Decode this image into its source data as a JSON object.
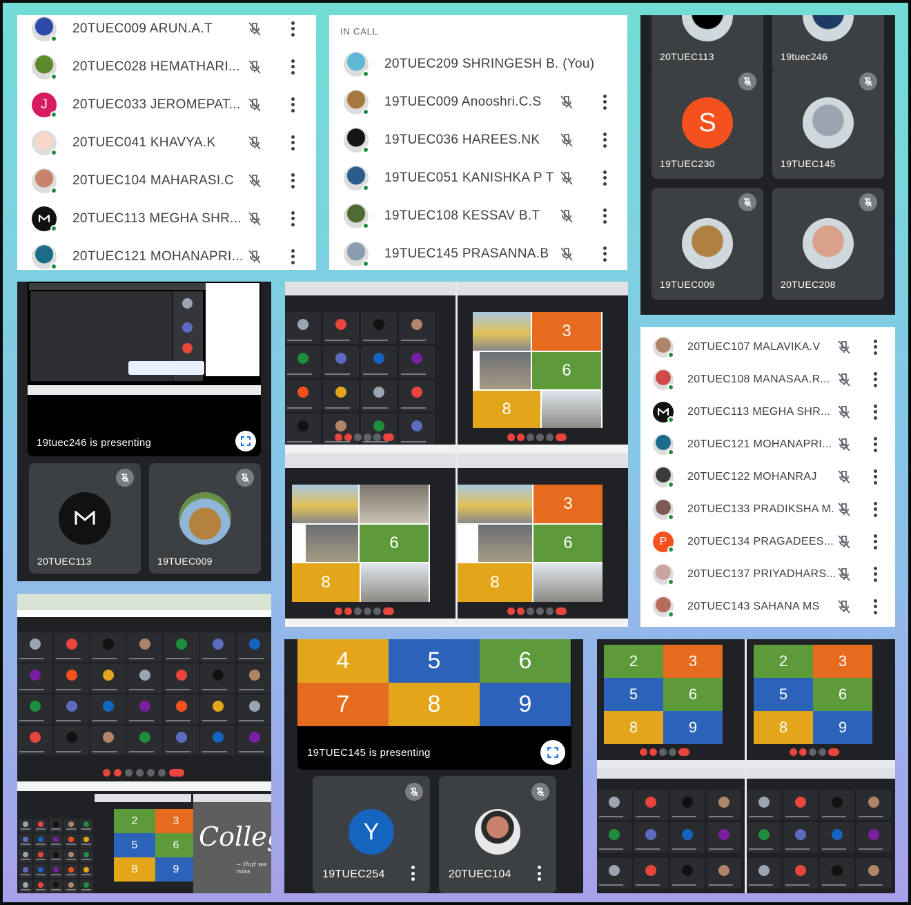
{
  "colors": {
    "green_online": "#1e8e3e",
    "orange": "#f2591b",
    "red": "#e8453c",
    "blue_y": "#1565c0",
    "grid_green": "#5d9a3a",
    "grid_orange": "#e66b1f",
    "grid_blue": "#2c63b8",
    "grid_yellow": "#e3a51a"
  },
  "panel1": {
    "participants": [
      {
        "name": "20TUEC009 ARUN.A.T",
        "avatar": "photo-globe",
        "color": "#2e4aa8"
      },
      {
        "name": "20TUEC028 HEMATHARI...",
        "avatar": "photo-fruit",
        "color": "#5a8a2a"
      },
      {
        "name": "20TUEC033 JEROMEPAT...",
        "avatar": "J",
        "color": "#d81b60"
      },
      {
        "name": "20TUEC041 KHAVYA.K",
        "avatar": "photo-signature",
        "color": "#f6d7c9"
      },
      {
        "name": "20TUEC104 MAHARASI.C",
        "avatar": "photo-person",
        "color": "#c9826b"
      },
      {
        "name": "20TUEC113 MEGHA SHR...",
        "avatar": "M-logo",
        "color": "#111111"
      },
      {
        "name": "20TUEC121 MOHANAPRI...",
        "avatar": "photo-person",
        "color": "#1b6b8a"
      }
    ]
  },
  "panel2": {
    "section_label": "IN CALL",
    "participants": [
      {
        "name": "20TUEC209 SHRINGESH B. (You)",
        "avatar": "photo-beach",
        "color": "#5fb7d4",
        "self": true
      },
      {
        "name": "19TUEC009 Anooshri.C.S",
        "avatar": "photo-dog",
        "color": "#a7783c"
      },
      {
        "name": "19TUEC036 HAREES.NK",
        "avatar": "photo-dark",
        "color": "#151515"
      },
      {
        "name": "19TUEC051 KANISHKA P T",
        "avatar": "photo-nature",
        "color": "#2a5d8a"
      },
      {
        "name": "19TUEC108 KESSAV B.T",
        "avatar": "photo-person",
        "color": "#4e6b32"
      },
      {
        "name": "19TUEC145 PRASANNA.B",
        "avatar": "photo-person",
        "color": "#8a9cb0"
      }
    ]
  },
  "panel3": {
    "tiles": [
      {
        "label": "20TUEC113",
        "avatar": "dark",
        "color": "#000000"
      },
      {
        "label": "19tuec246",
        "avatar": "photo",
        "color": "#1d3b62"
      },
      {
        "label": "19TUEC230",
        "avatar": "S",
        "color": "#f4511e"
      },
      {
        "label": "19TUEC145",
        "avatar": "photo-person",
        "color": "#9aa5b1"
      },
      {
        "label": "19TUEC009",
        "avatar": "photo-dog",
        "color": "#b08040"
      },
      {
        "label": "20TUEC208",
        "avatar": "photo-person",
        "color": "#d9a18a"
      }
    ]
  },
  "panel4": {
    "presenting": "19tuec246 is presenting",
    "tiles": [
      {
        "label": "20TUEC113",
        "avatar": "M-logo"
      },
      {
        "label": "19TUEC009",
        "avatar": "photo-dog"
      }
    ]
  },
  "panel6": {
    "participants": [
      {
        "name": "20TUEC107 MALAVIKA.V",
        "avatar": "photo-person",
        "color": "#b0856a"
      },
      {
        "name": "20TUEC108 MANASAA.R...",
        "avatar": "photo-person",
        "color": "#d04a4a"
      },
      {
        "name": "20TUEC113 MEGHA SHR...",
        "avatar": "M-logo",
        "color": "#111111"
      },
      {
        "name": "20TUEC121 MOHANAPRI...",
        "avatar": "photo-person",
        "color": "#1b6b8a"
      },
      {
        "name": "20TUEC122 MOHANRAJ",
        "avatar": "photo-dark",
        "color": "#3a3a3a"
      },
      {
        "name": "20TUEC133 PRADIKSHA M.",
        "avatar": "photo-person",
        "color": "#7a5a52"
      },
      {
        "name": "20TUEC134 PRAGADEES...",
        "avatar": "P",
        "color": "#f4511e"
      },
      {
        "name": "20TUEC137 PRIYADHARS...",
        "avatar": "photo-person",
        "color": "#c8a4a0"
      },
      {
        "name": "20TUEC143 SAHANA MS",
        "avatar": "photo-person",
        "color": "#b86a5c"
      }
    ]
  },
  "panel8": {
    "grid": [
      "4",
      "5",
      "6",
      "7",
      "8",
      "9"
    ],
    "presenting": "19TUEC145 is presenting",
    "tiles": [
      {
        "label": "19TUEC254",
        "avatar": "Y",
        "color": "#1565c0"
      },
      {
        "label": "20TUEC104",
        "avatar": "photo-person",
        "color": "#c9826b"
      }
    ]
  },
  "slides": {
    "a": [
      "3",
      "6",
      "8"
    ],
    "grid9": [
      "2",
      "3",
      "5",
      "6",
      "8",
      "9"
    ],
    "college": "College",
    "college_sub": "~ that we miss"
  }
}
